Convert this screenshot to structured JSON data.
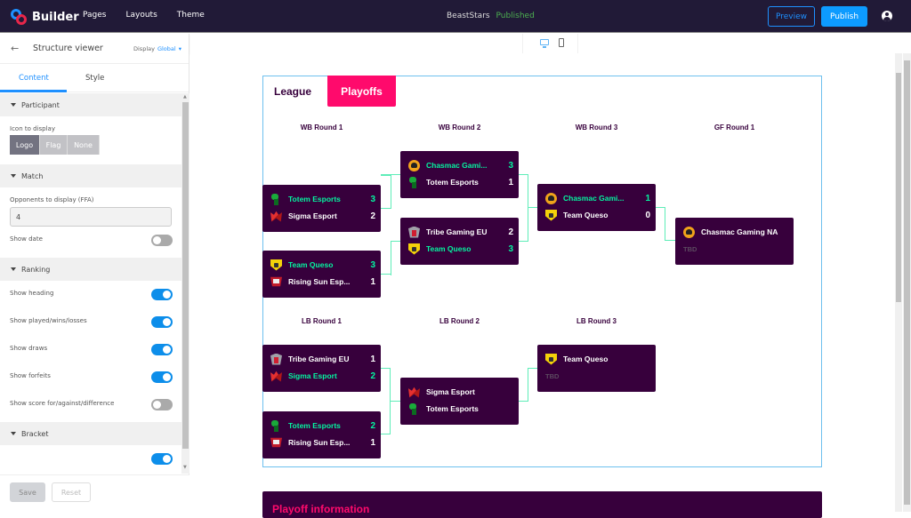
{
  "topbar": {
    "app_name": "Builder",
    "nav": [
      "Pages",
      "Layouts",
      "Theme"
    ],
    "site_name": "BeastStars",
    "site_status": "Published",
    "preview_label": "Preview",
    "publish_label": "Publish"
  },
  "sidebar": {
    "title": "Structure viewer",
    "display_label": "Display",
    "display_value": "Global",
    "tabs": [
      {
        "label": "Content",
        "active": true
      },
      {
        "label": "Style",
        "active": false
      }
    ],
    "sections": {
      "participant": {
        "title": "Participant",
        "icon_label": "Icon to display",
        "options": [
          "Logo",
          "Flag",
          "None"
        ],
        "selected": "Logo"
      },
      "match": {
        "title": "Match",
        "opponents_label": "Opponents to display (FFA)",
        "opponents_value": "4",
        "show_date_label": "Show date",
        "show_date": false
      },
      "ranking": {
        "title": "Ranking",
        "toggles": [
          {
            "label": "Show heading",
            "on": true
          },
          {
            "label": "Show played/wins/losses",
            "on": true
          },
          {
            "label": "Show draws",
            "on": true
          },
          {
            "label": "Show forfeits",
            "on": true
          },
          {
            "label": "Show score for/against/difference",
            "on": false
          }
        ]
      },
      "bracket": {
        "title": "Bracket"
      }
    },
    "save_label": "Save",
    "reset_label": "Reset"
  },
  "preview": {
    "tabs": [
      "League",
      "Playoffs"
    ],
    "active_tab": "Playoffs",
    "rounds": {
      "wb1": "WB Round 1",
      "wb2": "WB Round 2",
      "wb3": "WB Round 3",
      "gf1": "GF Round 1",
      "lb1": "LB Round 1",
      "lb2": "LB Round 2",
      "lb3": "LB Round 3"
    },
    "matches": {
      "wb1a": [
        {
          "name": "Totem Esports",
          "score": "3",
          "icon": "totem",
          "winner": true
        },
        {
          "name": "Sigma Esport",
          "score": "2",
          "icon": "sigma",
          "winner": false
        }
      ],
      "wb1b": [
        {
          "name": "Team Queso",
          "score": "3",
          "icon": "queso",
          "winner": true
        },
        {
          "name": "Rising Sun Esp...",
          "score": "1",
          "icon": "rising",
          "winner": false
        }
      ],
      "wb2a": [
        {
          "name": "Chasmac Gami...",
          "score": "3",
          "icon": "chasmac",
          "winner": true
        },
        {
          "name": "Totem Esports",
          "score": "1",
          "icon": "totem",
          "winner": false
        }
      ],
      "wb2b": [
        {
          "name": "Tribe Gaming EU",
          "score": "2",
          "icon": "tribe",
          "winner": false
        },
        {
          "name": "Team Queso",
          "score": "3",
          "icon": "queso",
          "winner": true
        }
      ],
      "wb3": [
        {
          "name": "Chasmac Gami...",
          "score": "1",
          "icon": "chasmac",
          "winner": true
        },
        {
          "name": "Team Queso",
          "score": "0",
          "icon": "queso",
          "winner": false
        }
      ],
      "gf1": [
        {
          "name": "Chasmac Gaming NA",
          "score": "",
          "icon": "chasmac",
          "winner": false
        },
        {
          "name": "TBD",
          "score": "",
          "icon": "",
          "winner": false
        }
      ],
      "lb1a": [
        {
          "name": "Tribe Gaming EU",
          "score": "1",
          "icon": "tribe",
          "winner": false
        },
        {
          "name": "Sigma Esport",
          "score": "2",
          "icon": "sigma",
          "winner": true
        }
      ],
      "lb1b": [
        {
          "name": "Totem Esports",
          "score": "2",
          "icon": "totem",
          "winner": true
        },
        {
          "name": "Rising Sun Esp...",
          "score": "1",
          "icon": "rising",
          "winner": false
        }
      ],
      "lb2": [
        {
          "name": "Sigma Esport",
          "score": "",
          "icon": "sigma",
          "winner": false
        },
        {
          "name": "Totem Esports",
          "score": "",
          "icon": "totem",
          "winner": false
        }
      ],
      "lb3": [
        {
          "name": "Team Queso",
          "score": "",
          "icon": "queso",
          "winner": false
        },
        {
          "name": "TBD",
          "score": "",
          "icon": "",
          "winner": false
        }
      ]
    },
    "info_title": "Playoff information"
  }
}
